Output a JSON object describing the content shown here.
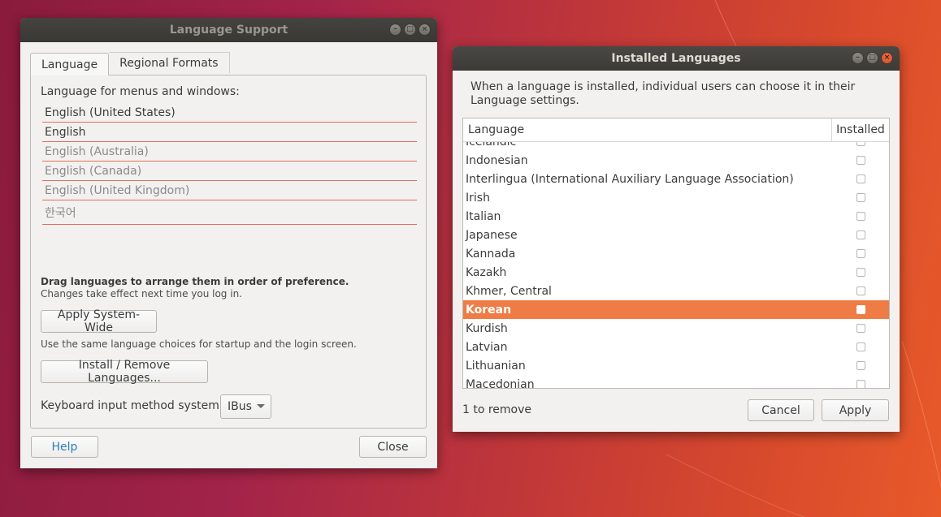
{
  "language_support": {
    "title": "Language Support",
    "tabs": [
      "Language",
      "Regional Formats"
    ],
    "menus_label": "Language for menus and windows:",
    "languages": [
      {
        "label": "English (United States)",
        "active": true
      },
      {
        "label": "English",
        "active": true
      },
      {
        "label": "English (Australia)",
        "active": false
      },
      {
        "label": "English (Canada)",
        "active": false
      },
      {
        "label": "English (United Kingdom)",
        "active": false
      },
      {
        "label": "한국어",
        "active": false
      }
    ],
    "drag_hint_bold": "Drag languages to arrange them in order of preference.",
    "drag_hint_sub": "Changes take effect next time you log in.",
    "apply_system_wide": "Apply System-Wide",
    "apply_hint": "Use the same language choices for startup and the login screen.",
    "install_remove": "Install / Remove Languages...",
    "keyboard_label": "Keyboard input method system:",
    "keyboard_value": "IBus",
    "help": "Help",
    "close": "Close"
  },
  "installed_languages": {
    "title": "Installed Languages",
    "description": "When a language is installed, individual users can choose it in their Language settings.",
    "columns": [
      "Language",
      "Installed"
    ],
    "rows": [
      {
        "name": "Icelandic",
        "installed": false,
        "selected": false
      },
      {
        "name": "Indonesian",
        "installed": false,
        "selected": false
      },
      {
        "name": "Interlingua (International Auxiliary Language Association)",
        "installed": false,
        "selected": false
      },
      {
        "name": "Irish",
        "installed": false,
        "selected": false
      },
      {
        "name": "Italian",
        "installed": false,
        "selected": false
      },
      {
        "name": "Japanese",
        "installed": false,
        "selected": false
      },
      {
        "name": "Kannada",
        "installed": false,
        "selected": false
      },
      {
        "name": "Kazakh",
        "installed": false,
        "selected": false
      },
      {
        "name": "Khmer, Central",
        "installed": false,
        "selected": false
      },
      {
        "name": "Korean",
        "installed": false,
        "selected": true
      },
      {
        "name": "Kurdish",
        "installed": false,
        "selected": false
      },
      {
        "name": "Latvian",
        "installed": false,
        "selected": false
      },
      {
        "name": "Lithuanian",
        "installed": false,
        "selected": false
      },
      {
        "name": "Macedonian",
        "installed": false,
        "selected": false
      }
    ],
    "status": "1 to remove",
    "cancel": "Cancel",
    "apply": "Apply"
  }
}
